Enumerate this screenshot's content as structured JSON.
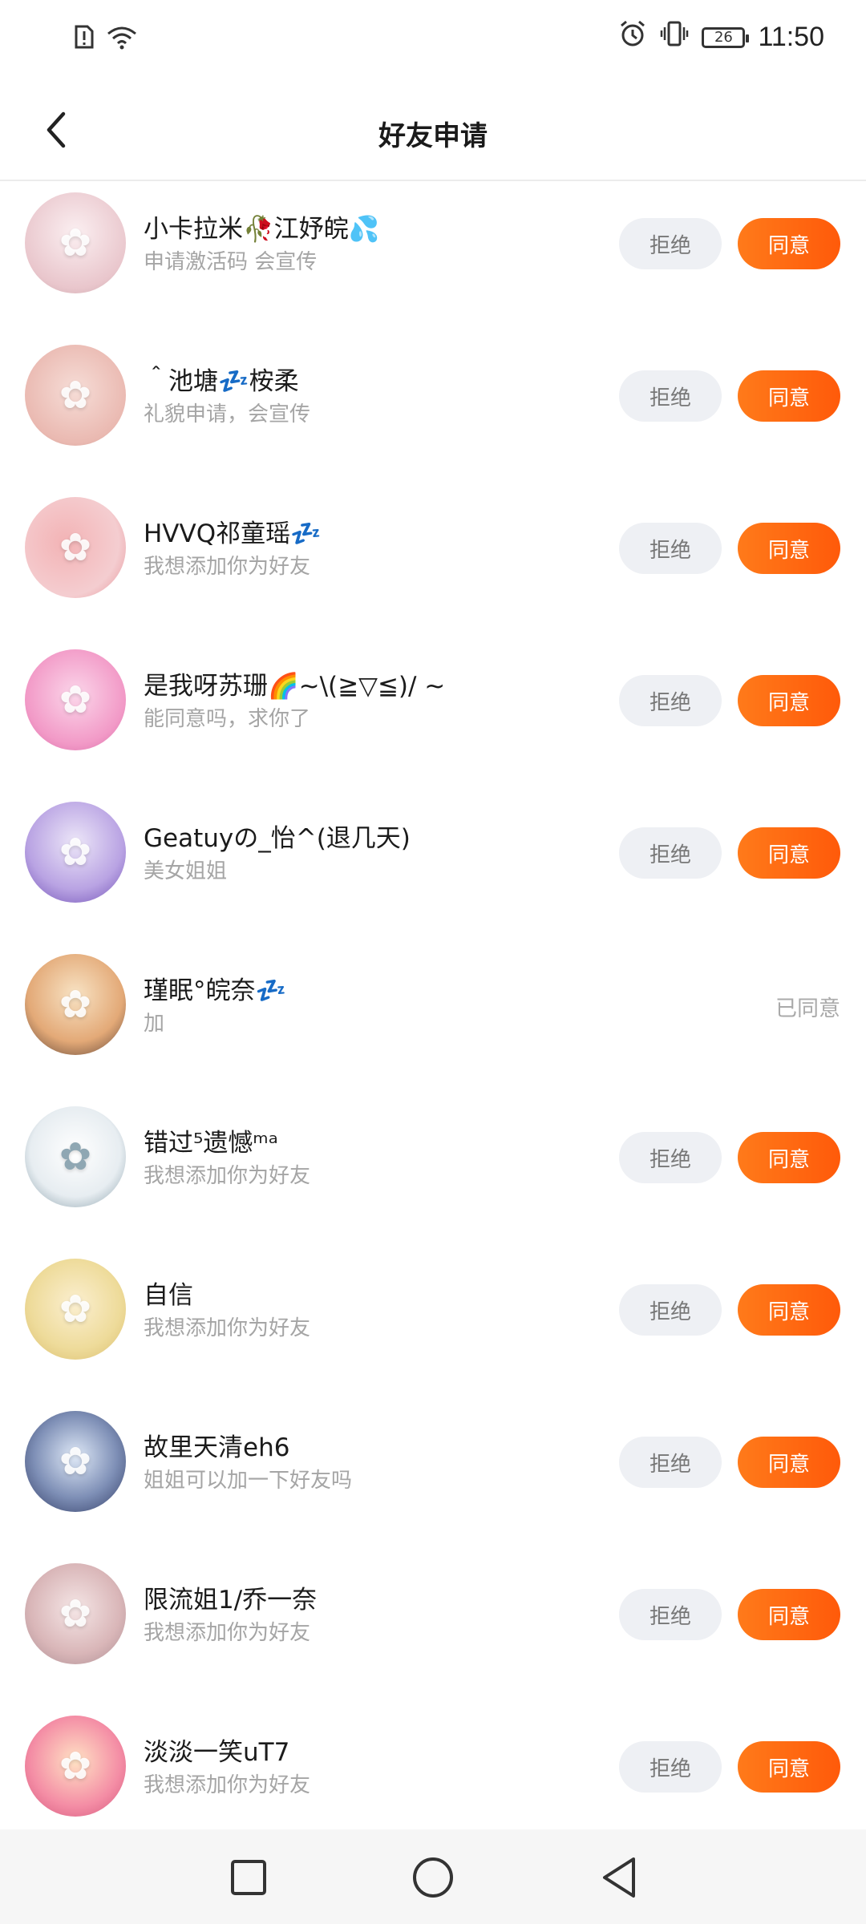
{
  "status_bar": {
    "time": "11:50",
    "battery": "26"
  },
  "header": {
    "title": "好友申请"
  },
  "colors": {
    "accent": "#ff6a10",
    "reject_bg": "#eef0f4",
    "subtext": "#a5a5a5"
  },
  "requests": [
    {
      "name": "小卡拉米🥀江妤皖💦",
      "message": "申请激活码 会宣传",
      "status": "pending",
      "reject_label": "拒绝",
      "accept_label": "同意"
    },
    {
      "name": "＾池塘💤桉柔",
      "message": "礼貌申请，会宣传",
      "status": "pending",
      "reject_label": "拒绝",
      "accept_label": "同意"
    },
    {
      "name": "HVVQ祁童瑶💤",
      "message": "我想添加你为好友",
      "status": "pending",
      "reject_label": "拒绝",
      "accept_label": "同意"
    },
    {
      "name": "是我呀苏珊🌈~\\(≧▽≦)/ ~",
      "message": "能同意吗，求你了",
      "status": "pending",
      "reject_label": "拒绝",
      "accept_label": "同意"
    },
    {
      "name": "Geatuyの_怡^(退几天)",
      "message": "美女姐姐",
      "status": "pending",
      "reject_label": "拒绝",
      "accept_label": "同意"
    },
    {
      "name": "瑾眠°皖奈💤",
      "message": "加",
      "status": "accepted",
      "status_label": "已同意"
    },
    {
      "name": "错过⁵遗憾ᵐᵃ",
      "message": "我想添加你为好友",
      "status": "pending",
      "reject_label": "拒绝",
      "accept_label": "同意"
    },
    {
      "name": "自信",
      "message": "我想添加你为好友",
      "status": "pending",
      "reject_label": "拒绝",
      "accept_label": "同意"
    },
    {
      "name": "故里天清eh6",
      "message": "姐姐可以加一下好友吗",
      "status": "pending",
      "reject_label": "拒绝",
      "accept_label": "同意"
    },
    {
      "name": "限流姐1/乔一奈",
      "message": "我想添加你为好友",
      "status": "pending",
      "reject_label": "拒绝",
      "accept_label": "同意"
    },
    {
      "name": "淡淡一笑uT7",
      "message": "我想添加你为好友",
      "status": "pending",
      "reject_label": "拒绝",
      "accept_label": "同意"
    }
  ]
}
